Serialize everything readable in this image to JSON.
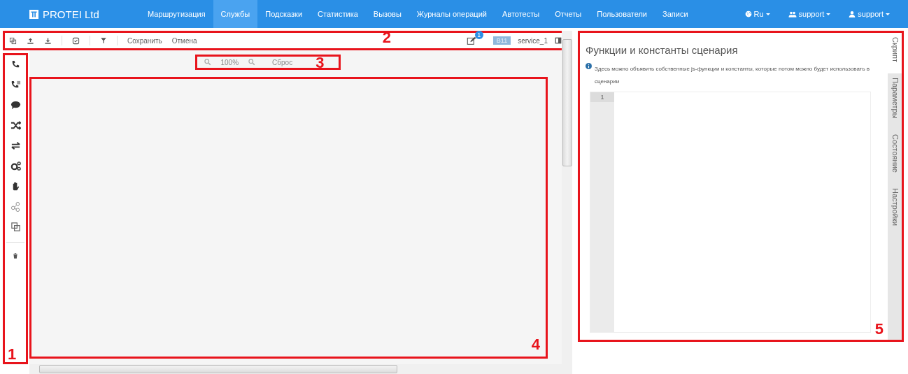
{
  "navbar": {
    "brand": "PROTEI Ltd",
    "items": [
      {
        "label": "Маршрутизация",
        "selected": false
      },
      {
        "label": "Службы",
        "selected": true
      },
      {
        "label": "Подсказки",
        "selected": false
      },
      {
        "label": "Статистика",
        "selected": false
      },
      {
        "label": "Вызовы",
        "selected": false
      },
      {
        "label": "Журналы операций",
        "selected": false
      },
      {
        "label": "Автотесты",
        "selected": false
      },
      {
        "label": "Отчеты",
        "selected": false
      },
      {
        "label": "Пользователи",
        "selected": false
      },
      {
        "label": "Записи",
        "selected": false
      }
    ],
    "language": "Ru",
    "group_menu": "support",
    "user_menu": "support"
  },
  "toolbar": {
    "save": "Сохранить",
    "cancel": "Отмена",
    "badge": "1",
    "tag": "B11",
    "service": "service_1"
  },
  "zoom": {
    "level": "100%",
    "reset": "Сброс",
    "disabled": true
  },
  "script_panel": {
    "title": "Функции и константы сценария",
    "hint": "Здесь можно объявить собственные js-функции и константы, которые потом можно будет использовать в сценарии",
    "line_numbers": [
      "1"
    ]
  },
  "side_tabs": [
    {
      "label": "Скрипт",
      "selected": true
    },
    {
      "label": "Параметры",
      "selected": false
    },
    {
      "label": "Состояние",
      "selected": false
    },
    {
      "label": "Настройки",
      "selected": false
    }
  ],
  "callouts": [
    "1",
    "2",
    "3",
    "4",
    "5"
  ]
}
